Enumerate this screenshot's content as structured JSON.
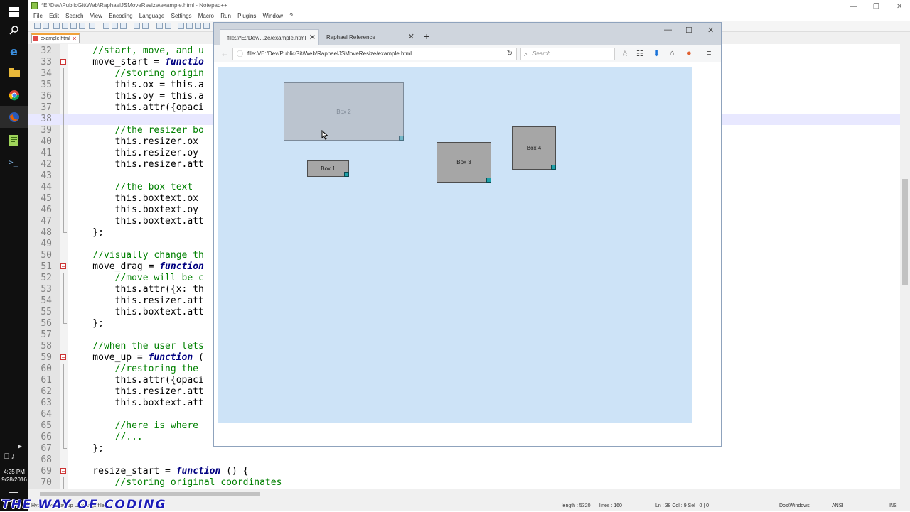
{
  "taskbar": {
    "clock_time": "4:25 PM",
    "clock_date": "9/28/2016"
  },
  "notepad": {
    "title": "*E:\\Dev\\PublicGit\\Web\\RaphaelJSMoveResize\\example.html - Notepad++",
    "menu": [
      "File",
      "Edit",
      "Search",
      "View",
      "Encoding",
      "Language",
      "Settings",
      "Macro",
      "Run",
      "Plugins",
      "Window",
      "?"
    ],
    "tab_label": "example.html",
    "lines": [
      {
        "n": "32",
        "text": "    //start, move, and u"
      },
      {
        "n": "33",
        "text": "    move_start = functio"
      },
      {
        "n": "34",
        "text": "        //storing origin"
      },
      {
        "n": "35",
        "text": "        this.ox = this.a"
      },
      {
        "n": "36",
        "text": "        this.oy = this.a"
      },
      {
        "n": "37",
        "text": "        this.attr({opaci"
      },
      {
        "n": "38",
        "text": ""
      },
      {
        "n": "39",
        "text": "        //the resizer bo"
      },
      {
        "n": "40",
        "text": "        this.resizer.ox"
      },
      {
        "n": "41",
        "text": "        this.resizer.oy"
      },
      {
        "n": "42",
        "text": "        this.resizer.att"
      },
      {
        "n": "43",
        "text": ""
      },
      {
        "n": "44",
        "text": "        //the box text"
      },
      {
        "n": "45",
        "text": "        this.boxtext.ox"
      },
      {
        "n": "46",
        "text": "        this.boxtext.oy"
      },
      {
        "n": "47",
        "text": "        this.boxtext.att"
      },
      {
        "n": "48",
        "text": "    };"
      },
      {
        "n": "49",
        "text": ""
      },
      {
        "n": "50",
        "text": "    //visually change th"
      },
      {
        "n": "51",
        "text": "    move_drag = function"
      },
      {
        "n": "52",
        "text": "        //move will be c"
      },
      {
        "n": "53",
        "text": "        this.attr({x: th"
      },
      {
        "n": "54",
        "text": "        this.resizer.att"
      },
      {
        "n": "55",
        "text": "        this.boxtext.att"
      },
      {
        "n": "56",
        "text": "    };"
      },
      {
        "n": "57",
        "text": ""
      },
      {
        "n": "58",
        "text": "    //when the user lets"
      },
      {
        "n": "59",
        "text": "    move_up = function ("
      },
      {
        "n": "60",
        "text": "        //restoring the"
      },
      {
        "n": "61",
        "text": "        this.attr({opaci"
      },
      {
        "n": "62",
        "text": "        this.resizer.att"
      },
      {
        "n": "63",
        "text": "        this.boxtext.att"
      },
      {
        "n": "64",
        "text": ""
      },
      {
        "n": "65",
        "text": "        //here is where"
      },
      {
        "n": "66",
        "text": "        //..."
      },
      {
        "n": "67",
        "text": "    };"
      },
      {
        "n": "68",
        "text": ""
      },
      {
        "n": "69",
        "text": "    resize_start = function () {"
      },
      {
        "n": "70",
        "text": "        //storing original coordinates"
      }
    ],
    "status": {
      "file_type": "Hyper Text Markup Language file",
      "length": "length : 5320",
      "lines": "lines : 160",
      "position": "Ln : 38    Col : 9    Sel : 0 | 0",
      "eol": "Dos\\Windows",
      "encoding": "ANSI",
      "mode": "INS"
    }
  },
  "watermark": "THE WAY OF CODING",
  "firefox": {
    "tab1_label": "file:///E:/Dev/...ze/example.html",
    "tab2_label": "Raphael Reference",
    "url": "file:///E:/Dev/PublicGit/Web/RaphaelJSMoveResize/example.html",
    "search_placeholder": "Search",
    "boxes": [
      {
        "label": "Box 2",
        "state": "dragging"
      },
      {
        "label": "Box 1",
        "state": "normal"
      },
      {
        "label": "Box 3",
        "state": "normal"
      },
      {
        "label": "Box 4",
        "state": "normal"
      }
    ]
  },
  "colors": {
    "canvas_bg": "#cde3f7",
    "box_fill": "#a6a6a6",
    "handle": "#1ea0a8",
    "comment": "#008000",
    "keyword": "#000080"
  }
}
